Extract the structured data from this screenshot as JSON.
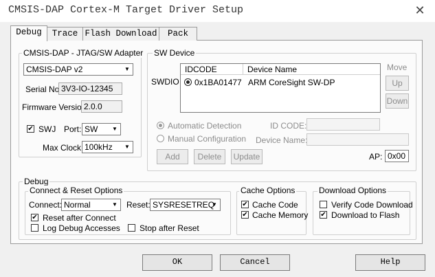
{
  "window": {
    "title": "CMSIS-DAP Cortex-M Target Driver Setup",
    "close_glyph": "✕"
  },
  "tabs": [
    {
      "label": "Debug",
      "active": true
    },
    {
      "label": "Trace",
      "active": false
    },
    {
      "label": "Flash Download",
      "active": false
    },
    {
      "label": "Pack",
      "active": false
    }
  ],
  "adapter": {
    "group_label": "CMSIS-DAP - JTAG/SW Adapter",
    "selected": "CMSIS-DAP v2",
    "serial_label": "Serial No:",
    "serial_value": "3V3-IO-12345",
    "firmware_label": "Firmware Version:",
    "firmware_value": "2.0.0",
    "swj_label": "SWJ",
    "swj_checked": true,
    "port_label": "Port:",
    "port_value": "SW",
    "clock_label": "Max Clock:",
    "clock_value": "100kHz"
  },
  "sw_device": {
    "group_label": "SW Device",
    "side_label": "SWDIO",
    "columns": [
      "IDCODE",
      "Device Name"
    ],
    "rows": [
      {
        "idcode": "0x1BA01477",
        "name": "ARM CoreSight SW-DP",
        "selected": true
      }
    ],
    "move_label": "Move",
    "up_label": "Up",
    "down_label": "Down",
    "auto_detect_label": "Automatic Detection",
    "manual_config_label": "Manual Configuration",
    "id_code_label": "ID CODE:",
    "device_name_label": "Device Name:",
    "add_label": "Add",
    "delete_label": "Delete",
    "update_label": "Update",
    "ap_label": "AP:",
    "ap_value": "0x00"
  },
  "debug": {
    "group_label": "Debug",
    "connect_reset": {
      "group_label": "Connect & Reset Options",
      "connect_label": "Connect:",
      "connect_value": "Normal",
      "reset_label": "Reset:",
      "reset_value": "SYSRESETREQ",
      "reset_after_connect_label": "Reset after Connect",
      "reset_after_connect_checked": true,
      "log_debug_label": "Log Debug Accesses",
      "log_debug_checked": false,
      "stop_after_reset_label": "Stop after Reset",
      "stop_after_reset_checked": false
    },
    "cache": {
      "group_label": "Cache Options",
      "cache_code_label": "Cache Code",
      "cache_code_checked": true,
      "cache_memory_label": "Cache Memory",
      "cache_memory_checked": true
    },
    "download": {
      "group_label": "Download Options",
      "verify_label": "Verify Code Download",
      "verify_checked": false,
      "flash_label": "Download to Flash",
      "flash_checked": true
    }
  },
  "footer": {
    "ok_label": "OK",
    "cancel_label": "Cancel",
    "help_label": "Help"
  },
  "glyphs": {
    "check": "✔",
    "arrow": "▼"
  }
}
